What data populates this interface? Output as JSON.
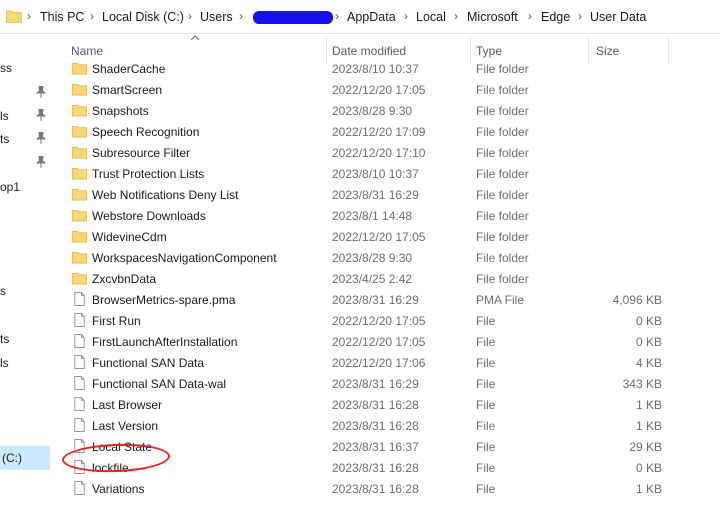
{
  "breadcrumb": {
    "items": [
      "This PC",
      "Local Disk (C:)",
      "Users",
      "AppData",
      "Local",
      "Microsoft",
      "Edge",
      "User Data"
    ]
  },
  "columns": {
    "name": "Name",
    "date": "Date modified",
    "type": "Type",
    "size": "Size"
  },
  "nav": {
    "fragments": [
      "ss",
      "ls",
      "ts",
      "op1",
      "s",
      "ts",
      "ls"
    ],
    "selected_label": "(C:)"
  },
  "rows": [
    {
      "name": "ShaderCache",
      "date": "2023/8/10 10:37",
      "type": "File folder",
      "size": "",
      "kind": "folder-icon"
    },
    {
      "name": "SmartScreen",
      "date": "2022/12/20 17:05",
      "type": "File folder",
      "size": "",
      "kind": "folder-icon"
    },
    {
      "name": "Snapshots",
      "date": "2023/8/28 9:30",
      "type": "File folder",
      "size": "",
      "kind": "folder-icon"
    },
    {
      "name": "Speech Recognition",
      "date": "2022/12/20 17:09",
      "type": "File folder",
      "size": "",
      "kind": "folder-icon"
    },
    {
      "name": "Subresource Filter",
      "date": "2022/12/20 17:10",
      "type": "File folder",
      "size": "",
      "kind": "folder-icon"
    },
    {
      "name": "Trust Protection Lists",
      "date": "2023/8/10 10:37",
      "type": "File folder",
      "size": "",
      "kind": "folder-icon"
    },
    {
      "name": "Web Notifications Deny List",
      "date": "2023/8/31 16:29",
      "type": "File folder",
      "size": "",
      "kind": "folder-icon"
    },
    {
      "name": "Webstore Downloads",
      "date": "2023/8/1 14:48",
      "type": "File folder",
      "size": "",
      "kind": "folder-icon"
    },
    {
      "name": "WidevineCdm",
      "date": "2022/12/20 17:05",
      "type": "File folder",
      "size": "",
      "kind": "folder-icon"
    },
    {
      "name": "WorkspacesNavigationComponent",
      "date": "2023/8/28 9:30",
      "type": "File folder",
      "size": "",
      "kind": "folder-icon"
    },
    {
      "name": "ZxcvbnData",
      "date": "2023/4/25 2:42",
      "type": "File folder",
      "size": "",
      "kind": "folder-icon"
    },
    {
      "name": "BrowserMetrics-spare.pma",
      "date": "2023/8/31 16:29",
      "type": "PMA File",
      "size": "4,096 KB",
      "kind": "file-icon"
    },
    {
      "name": "First Run",
      "date": "2022/12/20 17:05",
      "type": "File",
      "size": "0 KB",
      "kind": "file-icon"
    },
    {
      "name": "FirstLaunchAfterInstallation",
      "date": "2022/12/20 17:05",
      "type": "File",
      "size": "0 KB",
      "kind": "file-icon"
    },
    {
      "name": "Functional SAN Data",
      "date": "2022/12/20 17:06",
      "type": "File",
      "size": "4 KB",
      "kind": "file-icon"
    },
    {
      "name": "Functional SAN Data-wal",
      "date": "2023/8/31 16:29",
      "type": "File",
      "size": "343 KB",
      "kind": "file-icon"
    },
    {
      "name": "Last Browser",
      "date": "2023/8/31 16:28",
      "type": "File",
      "size": "1 KB",
      "kind": "file-icon"
    },
    {
      "name": "Last Version",
      "date": "2023/8/31 16:28",
      "type": "File",
      "size": "1 KB",
      "kind": "file-icon"
    },
    {
      "name": "Local State",
      "date": "2023/8/31 16:37",
      "type": "File",
      "size": "29 KB",
      "kind": "file-icon"
    },
    {
      "name": "lockfile",
      "date": "2023/8/31 16:28",
      "type": "File",
      "size": "0 KB",
      "kind": "file-icon"
    },
    {
      "name": "Variations",
      "date": "2023/8/31 16:28",
      "type": "File",
      "size": "1 KB",
      "kind": "file-icon"
    }
  ],
  "colors": {
    "folder": "#f8d775",
    "folder_dark": "#e0b24a",
    "annotation": "#e8231c",
    "selection": "#cce8ff",
    "redaction": "#1512f2"
  }
}
